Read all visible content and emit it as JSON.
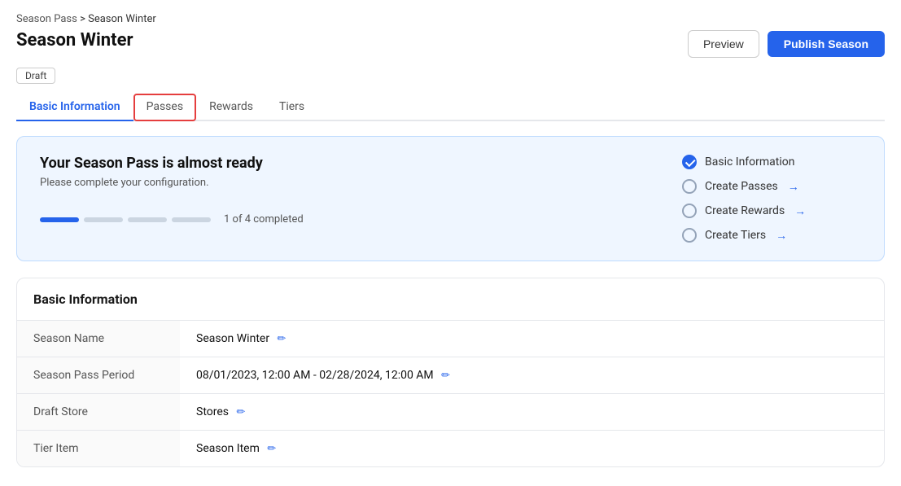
{
  "breadcrumb": {
    "parent": "Season Pass",
    "separator": ">",
    "current": "Season Winter"
  },
  "page": {
    "title": "Season Winter",
    "badge": "Draft"
  },
  "header_actions": {
    "preview_label": "Preview",
    "publish_label": "Publish Season"
  },
  "tabs": [
    {
      "id": "basic-information",
      "label": "Basic Information",
      "active": true,
      "highlighted": false
    },
    {
      "id": "passes",
      "label": "Passes",
      "active": false,
      "highlighted": true
    },
    {
      "id": "rewards",
      "label": "Rewards",
      "active": false,
      "highlighted": false
    },
    {
      "id": "tiers",
      "label": "Tiers",
      "active": false,
      "highlighted": false
    }
  ],
  "progress_card": {
    "heading": "Your Season Pass is almost ready",
    "subtext": "Please complete your configuration.",
    "progress_text": "1 of 4 completed",
    "segments": [
      {
        "filled": true
      },
      {
        "filled": false
      },
      {
        "filled": false
      },
      {
        "filled": false
      }
    ],
    "checklist": [
      {
        "label": "Basic Information",
        "checked": true,
        "arrow": false
      },
      {
        "label": "Create Passes",
        "checked": false,
        "arrow": true
      },
      {
        "label": "Create Rewards",
        "checked": false,
        "arrow": true
      },
      {
        "label": "Create Tiers",
        "checked": false,
        "arrow": true
      }
    ]
  },
  "basic_information": {
    "section_title": "Basic Information",
    "fields": [
      {
        "label": "Season Name",
        "value": "Season Winter"
      },
      {
        "label": "Season Pass Period",
        "value": "08/01/2023, 12:00 AM - 02/28/2024, 12:00 AM"
      },
      {
        "label": "Draft Store",
        "value": "Stores"
      },
      {
        "label": "Tier Item",
        "value": "Season Item"
      }
    ]
  },
  "icons": {
    "edit": "✏️",
    "arrow": "→",
    "checkmark": "✓"
  }
}
